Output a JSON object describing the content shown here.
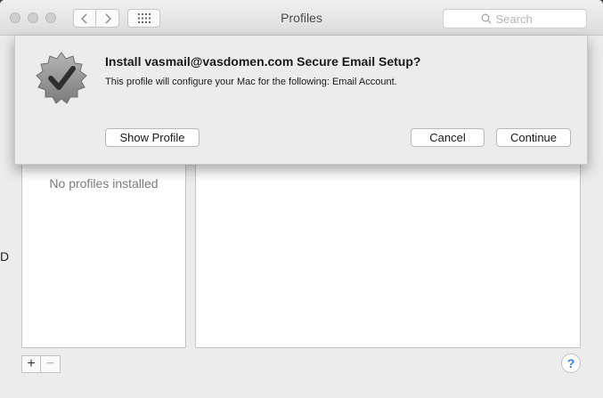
{
  "window": {
    "title": "Profiles",
    "search_placeholder": "Search"
  },
  "toolbar": {
    "back_icon": "chevron-left-icon",
    "forward_icon": "chevron-right-icon",
    "grid_icon": "grid-icon"
  },
  "sheet": {
    "title": "Install vasmail@vasdomen.com Secure Email Setup?",
    "message": "This profile will configure your Mac for the following: Email Account.",
    "show_profile_label": "Show Profile",
    "cancel_label": "Cancel",
    "continue_label": "Continue",
    "icon": "verified-badge-icon"
  },
  "main": {
    "empty_message": "No profiles installed",
    "add_label": "+",
    "remove_label": "−",
    "help_label": "?"
  },
  "colors": {
    "accent": "#3b7bd6",
    "window_bg": "#ececec"
  }
}
